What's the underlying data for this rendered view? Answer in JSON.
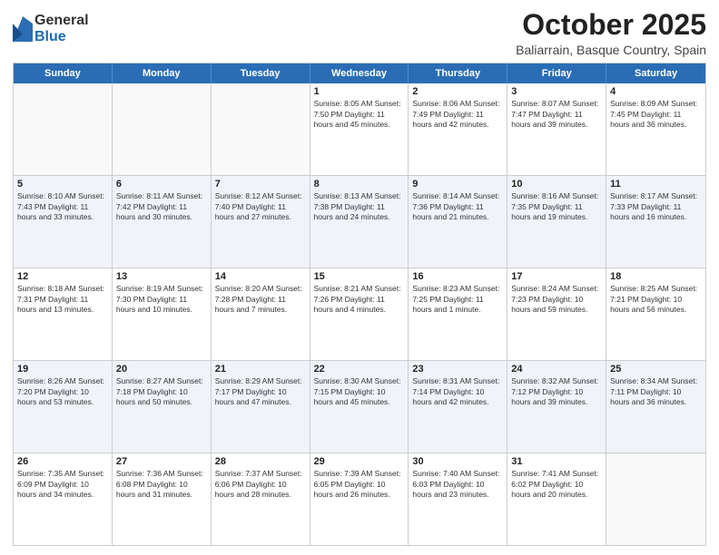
{
  "logo": {
    "general": "General",
    "blue": "Blue"
  },
  "title": "October 2025",
  "location": "Baliarrain, Basque Country, Spain",
  "days_of_week": [
    "Sunday",
    "Monday",
    "Tuesday",
    "Wednesday",
    "Thursday",
    "Friday",
    "Saturday"
  ],
  "rows": [
    {
      "shaded": false,
      "cells": [
        {
          "day": "",
          "info": ""
        },
        {
          "day": "",
          "info": ""
        },
        {
          "day": "",
          "info": ""
        },
        {
          "day": "1",
          "info": "Sunrise: 8:05 AM\nSunset: 7:50 PM\nDaylight: 11 hours and 45 minutes."
        },
        {
          "day": "2",
          "info": "Sunrise: 8:06 AM\nSunset: 7:49 PM\nDaylight: 11 hours and 42 minutes."
        },
        {
          "day": "3",
          "info": "Sunrise: 8:07 AM\nSunset: 7:47 PM\nDaylight: 11 hours and 39 minutes."
        },
        {
          "day": "4",
          "info": "Sunrise: 8:09 AM\nSunset: 7:45 PM\nDaylight: 11 hours and 36 minutes."
        }
      ]
    },
    {
      "shaded": true,
      "cells": [
        {
          "day": "5",
          "info": "Sunrise: 8:10 AM\nSunset: 7:43 PM\nDaylight: 11 hours and 33 minutes."
        },
        {
          "day": "6",
          "info": "Sunrise: 8:11 AM\nSunset: 7:42 PM\nDaylight: 11 hours and 30 minutes."
        },
        {
          "day": "7",
          "info": "Sunrise: 8:12 AM\nSunset: 7:40 PM\nDaylight: 11 hours and 27 minutes."
        },
        {
          "day": "8",
          "info": "Sunrise: 8:13 AM\nSunset: 7:38 PM\nDaylight: 11 hours and 24 minutes."
        },
        {
          "day": "9",
          "info": "Sunrise: 8:14 AM\nSunset: 7:36 PM\nDaylight: 11 hours and 21 minutes."
        },
        {
          "day": "10",
          "info": "Sunrise: 8:16 AM\nSunset: 7:35 PM\nDaylight: 11 hours and 19 minutes."
        },
        {
          "day": "11",
          "info": "Sunrise: 8:17 AM\nSunset: 7:33 PM\nDaylight: 11 hours and 16 minutes."
        }
      ]
    },
    {
      "shaded": false,
      "cells": [
        {
          "day": "12",
          "info": "Sunrise: 8:18 AM\nSunset: 7:31 PM\nDaylight: 11 hours and 13 minutes."
        },
        {
          "day": "13",
          "info": "Sunrise: 8:19 AM\nSunset: 7:30 PM\nDaylight: 11 hours and 10 minutes."
        },
        {
          "day": "14",
          "info": "Sunrise: 8:20 AM\nSunset: 7:28 PM\nDaylight: 11 hours and 7 minutes."
        },
        {
          "day": "15",
          "info": "Sunrise: 8:21 AM\nSunset: 7:26 PM\nDaylight: 11 hours and 4 minutes."
        },
        {
          "day": "16",
          "info": "Sunrise: 8:23 AM\nSunset: 7:25 PM\nDaylight: 11 hours and 1 minute."
        },
        {
          "day": "17",
          "info": "Sunrise: 8:24 AM\nSunset: 7:23 PM\nDaylight: 10 hours and 59 minutes."
        },
        {
          "day": "18",
          "info": "Sunrise: 8:25 AM\nSunset: 7:21 PM\nDaylight: 10 hours and 56 minutes."
        }
      ]
    },
    {
      "shaded": true,
      "cells": [
        {
          "day": "19",
          "info": "Sunrise: 8:26 AM\nSunset: 7:20 PM\nDaylight: 10 hours and 53 minutes."
        },
        {
          "day": "20",
          "info": "Sunrise: 8:27 AM\nSunset: 7:18 PM\nDaylight: 10 hours and 50 minutes."
        },
        {
          "day": "21",
          "info": "Sunrise: 8:29 AM\nSunset: 7:17 PM\nDaylight: 10 hours and 47 minutes."
        },
        {
          "day": "22",
          "info": "Sunrise: 8:30 AM\nSunset: 7:15 PM\nDaylight: 10 hours and 45 minutes."
        },
        {
          "day": "23",
          "info": "Sunrise: 8:31 AM\nSunset: 7:14 PM\nDaylight: 10 hours and 42 minutes."
        },
        {
          "day": "24",
          "info": "Sunrise: 8:32 AM\nSunset: 7:12 PM\nDaylight: 10 hours and 39 minutes."
        },
        {
          "day": "25",
          "info": "Sunrise: 8:34 AM\nSunset: 7:11 PM\nDaylight: 10 hours and 36 minutes."
        }
      ]
    },
    {
      "shaded": false,
      "cells": [
        {
          "day": "26",
          "info": "Sunrise: 7:35 AM\nSunset: 6:09 PM\nDaylight: 10 hours and 34 minutes."
        },
        {
          "day": "27",
          "info": "Sunrise: 7:36 AM\nSunset: 6:08 PM\nDaylight: 10 hours and 31 minutes."
        },
        {
          "day": "28",
          "info": "Sunrise: 7:37 AM\nSunset: 6:06 PM\nDaylight: 10 hours and 28 minutes."
        },
        {
          "day": "29",
          "info": "Sunrise: 7:39 AM\nSunset: 6:05 PM\nDaylight: 10 hours and 26 minutes."
        },
        {
          "day": "30",
          "info": "Sunrise: 7:40 AM\nSunset: 6:03 PM\nDaylight: 10 hours and 23 minutes."
        },
        {
          "day": "31",
          "info": "Sunrise: 7:41 AM\nSunset: 6:02 PM\nDaylight: 10 hours and 20 minutes."
        },
        {
          "day": "",
          "info": ""
        }
      ]
    }
  ]
}
